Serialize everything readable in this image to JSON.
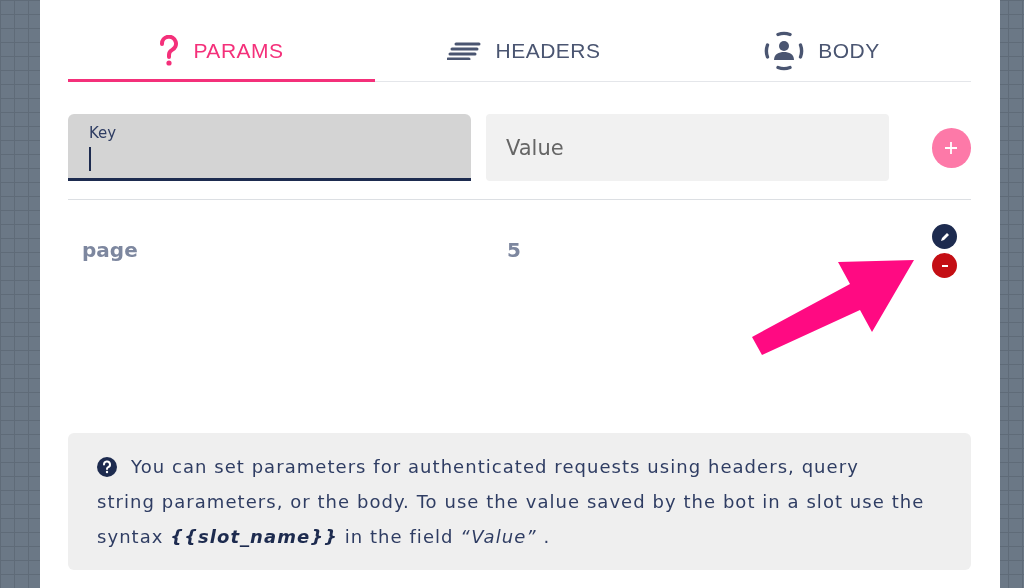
{
  "tabs": [
    {
      "label": "PARAMS",
      "kind": "question",
      "selected": true
    },
    {
      "label": "HEADERS",
      "kind": "lines",
      "selected": false
    },
    {
      "label": "BODY",
      "kind": "person",
      "selected": false
    }
  ],
  "key_field": {
    "label": "Key",
    "focused": true
  },
  "value_field": {
    "placeholder": "Value"
  },
  "params": [
    {
      "key": "page",
      "value": "5"
    }
  ],
  "info": [
    "You can set parameters for authenticated requests using headers, query",
    "string parameters, or the body. To use the value saved by the bot in a slot use the syntax **{{slot_name}}** in the field *“Value”* ."
  ]
}
